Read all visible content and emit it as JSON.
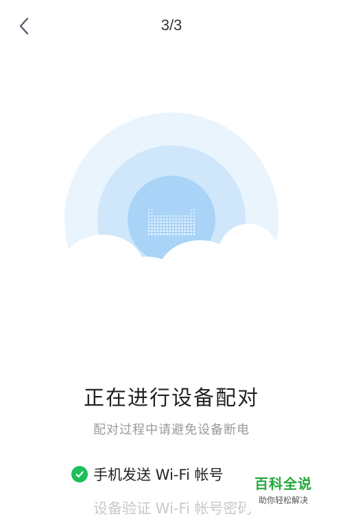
{
  "header": {
    "back_icon": "chevron-left-icon",
    "step_indicator": "3/3"
  },
  "main": {
    "title": "正在进行设备配对",
    "subtitle": "配对过程中请避免设备断电",
    "steps": [
      {
        "label": "手机发送 Wi-Fi 帐号",
        "status": "done",
        "icon": "check-circle-icon"
      },
      {
        "label": "设备验证 Wi-Fi 帐号密码",
        "status": "pending"
      }
    ]
  },
  "watermark": {
    "title": "百科全说",
    "subtitle": "助你轻松解决"
  },
  "colors": {
    "success": "#1bbf5c",
    "ring_outer": "#e9f4fd",
    "ring_middle": "#cfe6fb",
    "ring_inner": "#a9d3f7",
    "watermark_green": "#23a83a"
  }
}
